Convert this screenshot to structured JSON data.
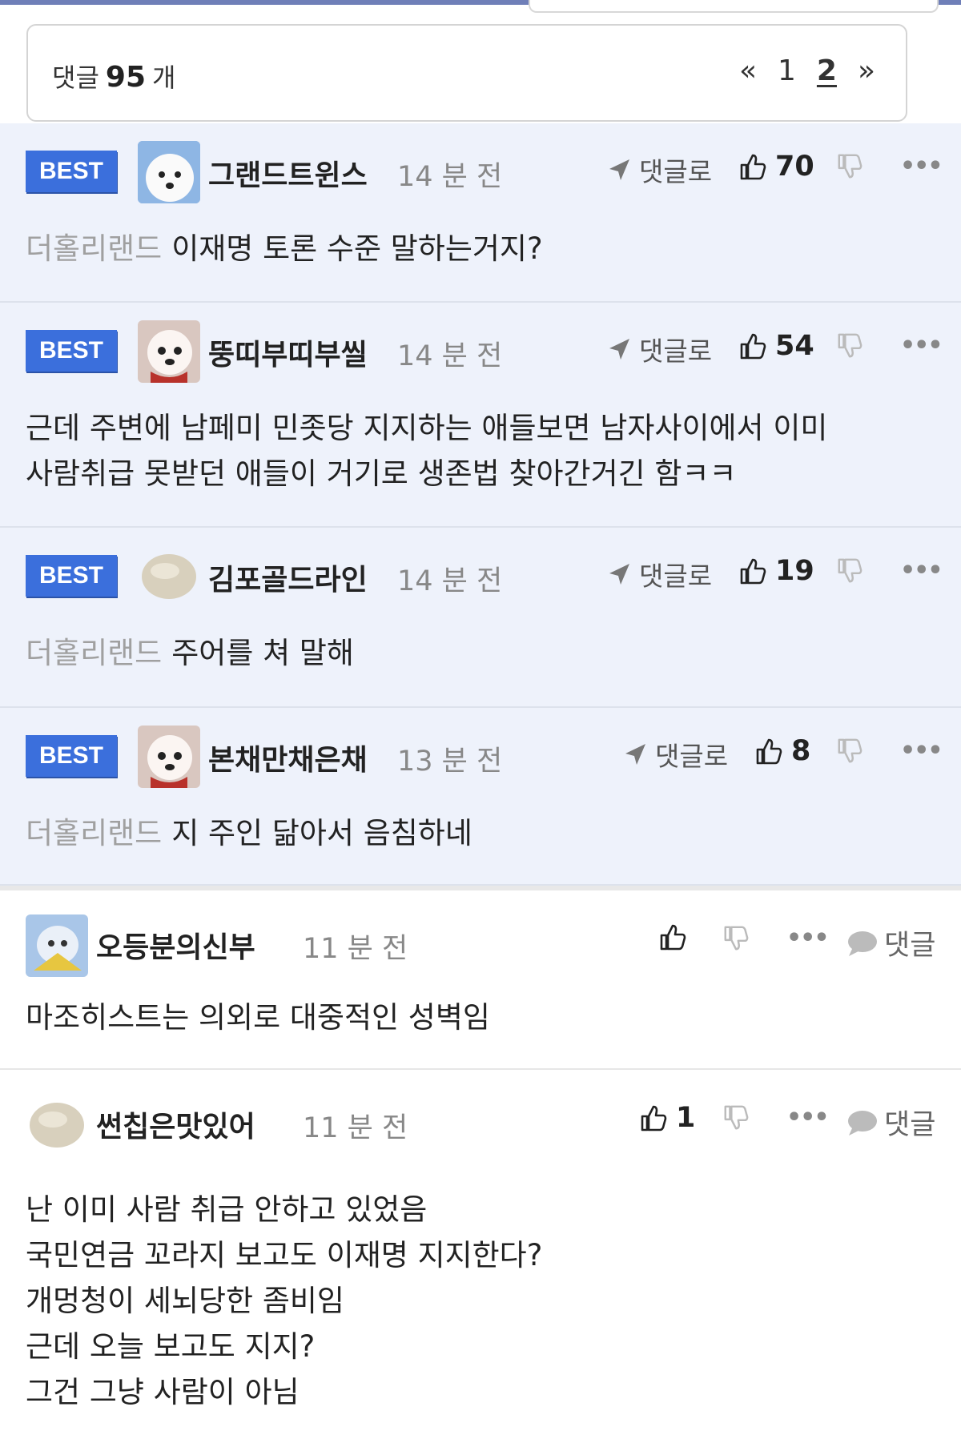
{
  "header": {
    "count_label": "댓글",
    "count_value": "95",
    "count_unit": "개",
    "pagination": {
      "prev": "«",
      "pages": [
        "1",
        "2"
      ],
      "current": "2",
      "next": "»"
    }
  },
  "best_comments": [
    {
      "badge": "BEST",
      "author": "그랜드트윈스",
      "time": "14 분 전",
      "reply_to_label": "댓글로",
      "likes": "70",
      "category": "더홀리랜드",
      "text": "이재명 토론 수준 말하는거지?",
      "avatar": "dog-avatar"
    },
    {
      "badge": "BEST",
      "author": "뚱띠부띠부씰",
      "time": "14 분 전",
      "reply_to_label": "댓글로",
      "likes": "54",
      "category": "",
      "text_lines": [
        "근데 주변에 남페미 민좃당 지지하는 애들보면 남자사이에서 이미",
        "사람취급 못받던 애들이 거기로 생존법 찾아간거긴 함ㅋㅋ"
      ],
      "avatar": "dog-avatar"
    },
    {
      "badge": "BEST",
      "author": "김포골드라인",
      "time": "14 분 전",
      "reply_to_label": "댓글로",
      "likes": "19",
      "category": "더홀리랜드",
      "text": "주어를 쳐 말해",
      "avatar": "blob-avatar"
    },
    {
      "badge": "BEST",
      "author": "본채만채은채",
      "time": "13 분 전",
      "reply_to_label": "댓글로",
      "likes": "8",
      "category": "더홀리랜드",
      "text": "지 주인 닮아서 음침하네",
      "avatar": "dog-avatar"
    }
  ],
  "comments": [
    {
      "author": "오등분의신부",
      "time": "11 분 전",
      "likes": "",
      "reply_label": "댓글",
      "text_lines": [
        "마조히스트는 의외로 대중적인 성벽임"
      ],
      "avatar": "character-avatar"
    },
    {
      "author": "썬칩은맛있어",
      "time": "11 분 전",
      "likes": "1",
      "reply_label": "댓글",
      "text_lines": [
        "난 이미 사람 취급 안하고 있었음",
        "국민연금 꼬라지 보고도 이재명 지지한다?",
        "개멍청이 세뇌당한 좀비임",
        "근데 오늘 보고도 지지?",
        "그건 그냥 사람이 아님"
      ],
      "avatar": "blob-avatar"
    }
  ],
  "colors": {
    "best_bg": "#eef2fb",
    "badge_bg": "#3b6fdc",
    "category_text": "#a0a0a0"
  }
}
